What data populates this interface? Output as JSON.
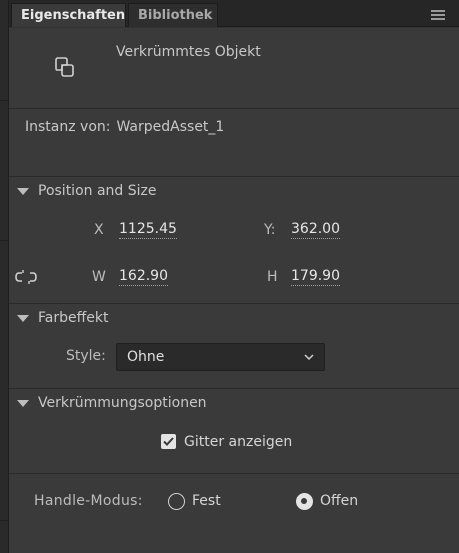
{
  "tabs": [
    {
      "label": "Eigenschaften",
      "active": true
    },
    {
      "label": "Bibliothek",
      "active": false
    }
  ],
  "object": {
    "type_label": "Verkrümmtes Objekt",
    "icon": "warped-shape-icon"
  },
  "instance": {
    "label": "Instanz von:",
    "value": "WarpedAsset_1"
  },
  "position_size": {
    "header": "Position and Size",
    "x_label": "X",
    "x_value": "1125.45",
    "y_label": "Y:",
    "y_value": "362.00",
    "w_label": "W",
    "w_value": "162.90",
    "h_label": "H",
    "h_value": "179.90",
    "link_icon": "chain-link-icon"
  },
  "color_effect": {
    "header": "Farbeffekt",
    "style_label": "Style:",
    "style_value": "Ohne"
  },
  "warp_options": {
    "header": "Verkrümmungsoptionen",
    "show_grid_label": "Gitter anzeigen",
    "show_grid_checked": true,
    "handle_mode_label": "Handle-Modus:",
    "handle_mode_options": [
      "Fest",
      "Offen"
    ],
    "handle_mode_selected": "Offen"
  },
  "colors": {
    "panel_bg": "#3a3a3a",
    "tabbar_bg": "#262626",
    "text": "#c8c8c8"
  }
}
